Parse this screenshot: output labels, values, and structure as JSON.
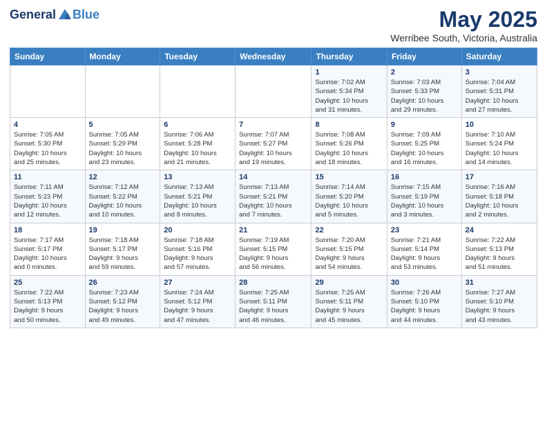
{
  "header": {
    "logo_general": "General",
    "logo_blue": "Blue",
    "month_title": "May 2025",
    "location": "Werribee South, Victoria, Australia"
  },
  "weekdays": [
    "Sunday",
    "Monday",
    "Tuesday",
    "Wednesday",
    "Thursday",
    "Friday",
    "Saturday"
  ],
  "weeks": [
    [
      {
        "day": "",
        "info": ""
      },
      {
        "day": "",
        "info": ""
      },
      {
        "day": "",
        "info": ""
      },
      {
        "day": "",
        "info": ""
      },
      {
        "day": "1",
        "info": "Sunrise: 7:02 AM\nSunset: 5:34 PM\nDaylight: 10 hours\nand 31 minutes."
      },
      {
        "day": "2",
        "info": "Sunrise: 7:03 AM\nSunset: 5:33 PM\nDaylight: 10 hours\nand 29 minutes."
      },
      {
        "day": "3",
        "info": "Sunrise: 7:04 AM\nSunset: 5:31 PM\nDaylight: 10 hours\nand 27 minutes."
      }
    ],
    [
      {
        "day": "4",
        "info": "Sunrise: 7:05 AM\nSunset: 5:30 PM\nDaylight: 10 hours\nand 25 minutes."
      },
      {
        "day": "5",
        "info": "Sunrise: 7:05 AM\nSunset: 5:29 PM\nDaylight: 10 hours\nand 23 minutes."
      },
      {
        "day": "6",
        "info": "Sunrise: 7:06 AM\nSunset: 5:28 PM\nDaylight: 10 hours\nand 21 minutes."
      },
      {
        "day": "7",
        "info": "Sunrise: 7:07 AM\nSunset: 5:27 PM\nDaylight: 10 hours\nand 19 minutes."
      },
      {
        "day": "8",
        "info": "Sunrise: 7:08 AM\nSunset: 5:26 PM\nDaylight: 10 hours\nand 18 minutes."
      },
      {
        "day": "9",
        "info": "Sunrise: 7:09 AM\nSunset: 5:25 PM\nDaylight: 10 hours\nand 16 minutes."
      },
      {
        "day": "10",
        "info": "Sunrise: 7:10 AM\nSunset: 5:24 PM\nDaylight: 10 hours\nand 14 minutes."
      }
    ],
    [
      {
        "day": "11",
        "info": "Sunrise: 7:11 AM\nSunset: 5:23 PM\nDaylight: 10 hours\nand 12 minutes."
      },
      {
        "day": "12",
        "info": "Sunrise: 7:12 AM\nSunset: 5:22 PM\nDaylight: 10 hours\nand 10 minutes."
      },
      {
        "day": "13",
        "info": "Sunrise: 7:13 AM\nSunset: 5:21 PM\nDaylight: 10 hours\nand 8 minutes."
      },
      {
        "day": "14",
        "info": "Sunrise: 7:13 AM\nSunset: 5:21 PM\nDaylight: 10 hours\nand 7 minutes."
      },
      {
        "day": "15",
        "info": "Sunrise: 7:14 AM\nSunset: 5:20 PM\nDaylight: 10 hours\nand 5 minutes."
      },
      {
        "day": "16",
        "info": "Sunrise: 7:15 AM\nSunset: 5:19 PM\nDaylight: 10 hours\nand 3 minutes."
      },
      {
        "day": "17",
        "info": "Sunrise: 7:16 AM\nSunset: 5:18 PM\nDaylight: 10 hours\nand 2 minutes."
      }
    ],
    [
      {
        "day": "18",
        "info": "Sunrise: 7:17 AM\nSunset: 5:17 PM\nDaylight: 10 hours\nand 0 minutes."
      },
      {
        "day": "19",
        "info": "Sunrise: 7:18 AM\nSunset: 5:17 PM\nDaylight: 9 hours\nand 59 minutes."
      },
      {
        "day": "20",
        "info": "Sunrise: 7:18 AM\nSunset: 5:16 PM\nDaylight: 9 hours\nand 57 minutes."
      },
      {
        "day": "21",
        "info": "Sunrise: 7:19 AM\nSunset: 5:15 PM\nDaylight: 9 hours\nand 56 minutes."
      },
      {
        "day": "22",
        "info": "Sunrise: 7:20 AM\nSunset: 5:15 PM\nDaylight: 9 hours\nand 54 minutes."
      },
      {
        "day": "23",
        "info": "Sunrise: 7:21 AM\nSunset: 5:14 PM\nDaylight: 9 hours\nand 53 minutes."
      },
      {
        "day": "24",
        "info": "Sunrise: 7:22 AM\nSunset: 5:13 PM\nDaylight: 9 hours\nand 51 minutes."
      }
    ],
    [
      {
        "day": "25",
        "info": "Sunrise: 7:22 AM\nSunset: 5:13 PM\nDaylight: 9 hours\nand 50 minutes."
      },
      {
        "day": "26",
        "info": "Sunrise: 7:23 AM\nSunset: 5:12 PM\nDaylight: 9 hours\nand 49 minutes."
      },
      {
        "day": "27",
        "info": "Sunrise: 7:24 AM\nSunset: 5:12 PM\nDaylight: 9 hours\nand 47 minutes."
      },
      {
        "day": "28",
        "info": "Sunrise: 7:25 AM\nSunset: 5:11 PM\nDaylight: 9 hours\nand 46 minutes."
      },
      {
        "day": "29",
        "info": "Sunrise: 7:25 AM\nSunset: 5:11 PM\nDaylight: 9 hours\nand 45 minutes."
      },
      {
        "day": "30",
        "info": "Sunrise: 7:26 AM\nSunset: 5:10 PM\nDaylight: 9 hours\nand 44 minutes."
      },
      {
        "day": "31",
        "info": "Sunrise: 7:27 AM\nSunset: 5:10 PM\nDaylight: 9 hours\nand 43 minutes."
      }
    ]
  ]
}
